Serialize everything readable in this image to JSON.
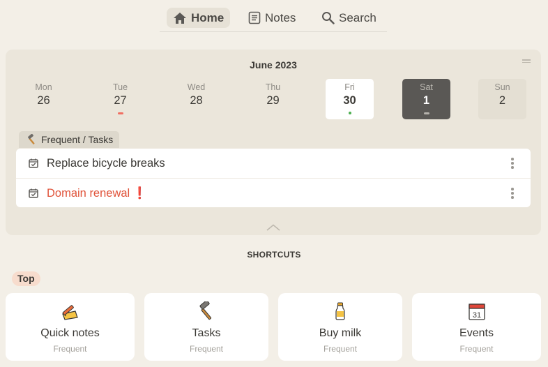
{
  "nav": {
    "items": [
      {
        "label": "Home",
        "icon": "home-icon",
        "active": true
      },
      {
        "label": "Notes",
        "icon": "notes-icon",
        "active": false
      },
      {
        "label": "Search",
        "icon": "search-icon",
        "active": false
      }
    ]
  },
  "calendar": {
    "month_label": "June 2023",
    "days": [
      {
        "name": "Mon",
        "date": "26"
      },
      {
        "name": "Tue",
        "date": "27",
        "marker": "#f06f62"
      },
      {
        "name": "Wed",
        "date": "28"
      },
      {
        "name": "Thu",
        "date": "29"
      },
      {
        "name": "Fri",
        "date": "30",
        "marker": "#4caf50",
        "state": "today"
      },
      {
        "name": "Sat",
        "date": "1",
        "marker": "#b5b2ac",
        "state": "selected"
      },
      {
        "name": "Sun",
        "date": "2"
      }
    ]
  },
  "tasks": {
    "section_label": "Frequent / Tasks",
    "section_icon": "hammer-icon",
    "items": [
      {
        "label": "Replace bicycle breaks",
        "overdue": false
      },
      {
        "label": "Domain renewal",
        "overdue": true,
        "flag": "❗"
      }
    ]
  },
  "shortcuts": {
    "title": "SHORTCUTS",
    "group_label": "Top",
    "cards": [
      {
        "name": "Quick notes",
        "subtitle": "Frequent",
        "icon": "memo-pencil-icon"
      },
      {
        "name": "Tasks",
        "subtitle": "Frequent",
        "icon": "hammer-icon"
      },
      {
        "name": "Buy milk",
        "subtitle": "Frequent",
        "icon": "milk-bottle-icon"
      },
      {
        "name": "Events",
        "subtitle": "Frequent",
        "icon": "calendar-icon"
      }
    ]
  },
  "colors": {
    "background": "#f3efe7",
    "panel": "#ebe6db",
    "selected_day": "#5a5855",
    "overdue_text": "#e0533a",
    "top_pill": "#f7dccd"
  }
}
